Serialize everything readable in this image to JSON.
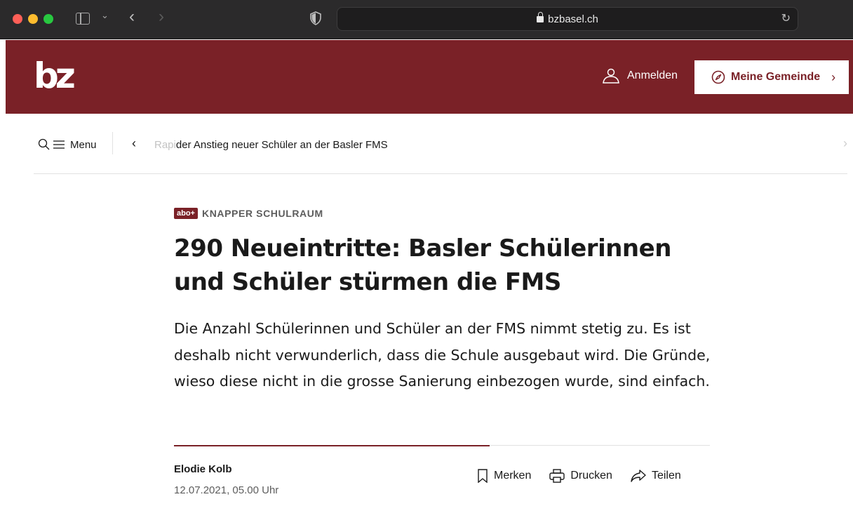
{
  "browser": {
    "url": "bzbasel.ch"
  },
  "header": {
    "logo": "bz",
    "login_label": "Anmelden",
    "gemeinde_label": "Meine Gemeinde",
    "brand_color": "#7a2127"
  },
  "subnav": {
    "menu_label": "Menu",
    "article_title_faded": "Rapi",
    "article_title_rest": "der Anstieg neuer Schüler an der Basler FMS"
  },
  "article": {
    "badge": "abo+",
    "kicker": "KNAPPER SCHULRAUM",
    "headline": "290 Neueintritte: Basler Schülerinnen und Schüler stürmen die FMS",
    "lead": "Die Anzahl Schülerinnen und Schüler an der FMS nimmt stetig zu. Es ist deshalb nicht verwunderlich, dass die Schule ausgebaut wird. Die Gründe, wieso diese nicht in die grosse Sanierung einbezogen wurde, sind einfach.",
    "author": "Elodie Kolb",
    "date": "12.07.2021, 05.00 Uhr",
    "actions": {
      "bookmark": "Merken",
      "print": "Drucken",
      "share": "Teilen"
    }
  },
  "icons": [
    "sidebar-icon",
    "chevron-down-icon",
    "back-icon",
    "forward-icon",
    "shield-icon",
    "lock-icon",
    "reload-icon",
    "user-icon",
    "compass-icon",
    "chevron-right-icon",
    "search-icon",
    "hamburger-icon",
    "bookmark-icon",
    "printer-icon",
    "share-icon"
  ]
}
